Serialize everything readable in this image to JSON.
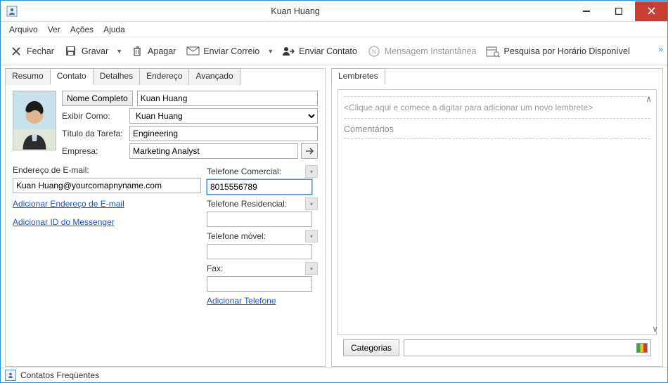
{
  "window": {
    "title": "Kuan Huang"
  },
  "menu": {
    "file": "Arquivo",
    "view": "Ver",
    "actions": "Ações",
    "help": "Ajuda"
  },
  "toolbar": {
    "close": "Fechar",
    "save": "Gravar",
    "delete": "Apagar",
    "send_mail": "Enviar Correio",
    "send_contact": "Enviar Contato",
    "im": "Mensagem Instantânea",
    "search_free": "Pesquisa por Horário Disponível"
  },
  "tabs_left": {
    "summary": "Resumo",
    "contact": "Contato",
    "details": "Detalhes",
    "address": "Endereço",
    "advanced": "Avançado"
  },
  "tabs_right": {
    "reminders": "Lembretes"
  },
  "contact": {
    "full_name_btn": "Nome Completo",
    "full_name_value": "Kuan Huang",
    "display_as_label": "Exibir Como:",
    "display_as_value": "Kuan Huang",
    "job_title_label": "Título da Tarefa:",
    "job_title_value": "Engineering",
    "company_label": "Empresa:",
    "company_value": "Marketing Analyst",
    "email_label": "Endereço de E-mail:",
    "email_value": "Kuan Huang@yourcomapnyname.com",
    "add_email_link": "Adicionar Endereço de E-mail",
    "add_im_link": "Adicionar ID do Messenger",
    "phone_business_label": "Telefone Comercial:",
    "phone_business_value": "8015556789",
    "phone_home_label": "Telefone Residencial:",
    "phone_home_value": "",
    "phone_mobile_label": "Telefone móvel:",
    "phone_mobile_value": "",
    "phone_fax_label": "Fax:",
    "phone_fax_value": "",
    "add_phone_link": "Adicionar Telefone"
  },
  "reminders": {
    "placeholder": "<Clique aqui e comece a digitar para adicionar um novo lembrete>",
    "comments_label": "Comentários",
    "categories_btn": "Categorias"
  },
  "statusbar": {
    "frequent_contacts": "Contatos Freqüentes"
  }
}
